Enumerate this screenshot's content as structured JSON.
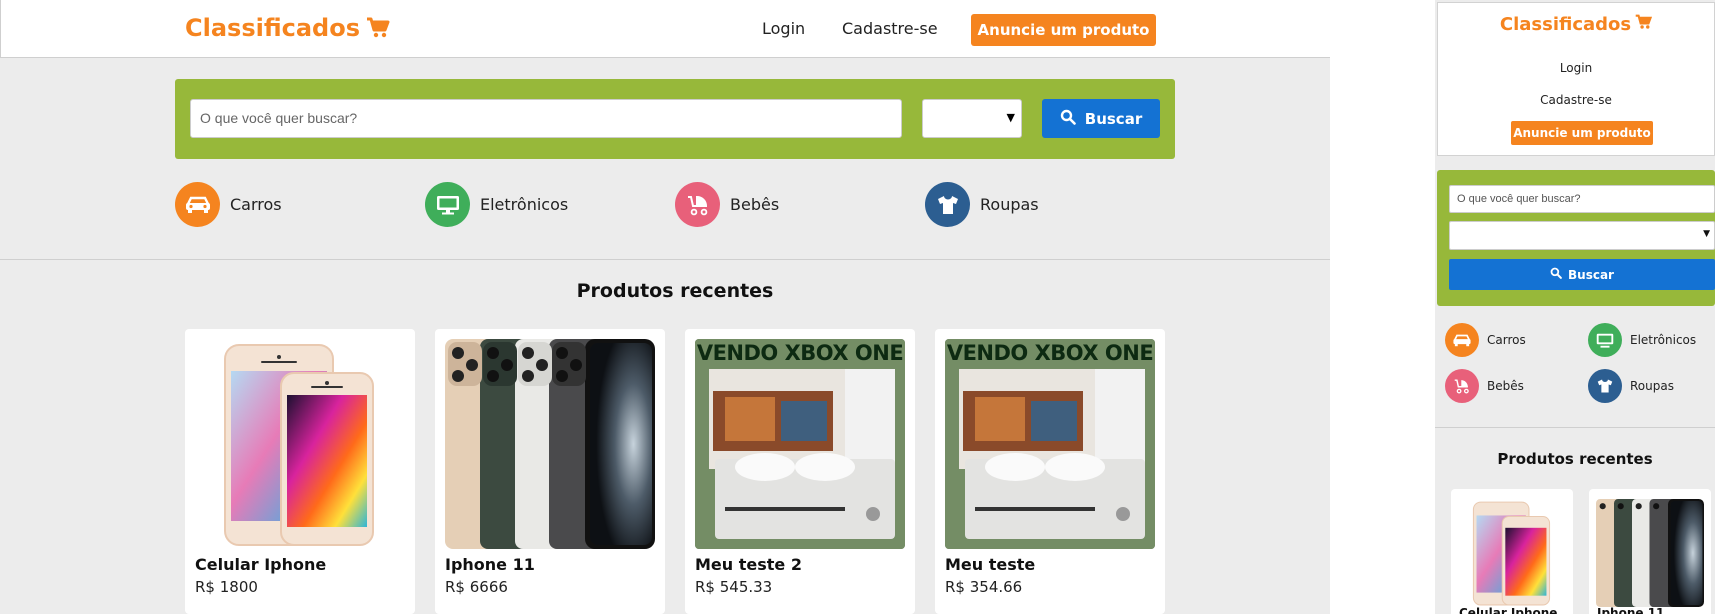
{
  "brand": {
    "name": "Classificados",
    "color": "#f5841f",
    "icon": "shopping-cart-icon"
  },
  "nav": {
    "login": "Login",
    "signup": "Cadastre-se",
    "announce": "Anuncie um produto"
  },
  "search": {
    "placeholder": "O que você quer buscar?",
    "button": "Buscar",
    "select_value": ""
  },
  "categories": [
    {
      "label": "Carros",
      "icon": "car-icon",
      "color": "#f5841f"
    },
    {
      "label": "Eletrônicos",
      "icon": "monitor-icon",
      "color": "#3fae5a"
    },
    {
      "label": "Bebês",
      "icon": "baby-stroller-icon",
      "color": "#e8607a"
    },
    {
      "label": "Roupas",
      "icon": "tshirt-icon",
      "color": "#2c5e91"
    }
  ],
  "recent": {
    "title": "Produtos recentes",
    "products": [
      {
        "name": "Celular Iphone",
        "price": "R$ 1800"
      },
      {
        "name": "Iphone 11",
        "price": "R$ 6666"
      },
      {
        "name": "Meu teste 2",
        "price": "R$ 545.33",
        "image_text": "VENDO XBOX ONE"
      },
      {
        "name": "Meu teste",
        "price": "R$ 354.66",
        "image_text": "VENDO XBOX ONE"
      }
    ]
  },
  "mobile": {
    "products": [
      {
        "name": "Celular Iphone"
      },
      {
        "name": "Iphone 11"
      }
    ]
  },
  "colors": {
    "accent": "#f5841f",
    "search_bg": "#97b83a",
    "button_blue": "#1472d3"
  }
}
